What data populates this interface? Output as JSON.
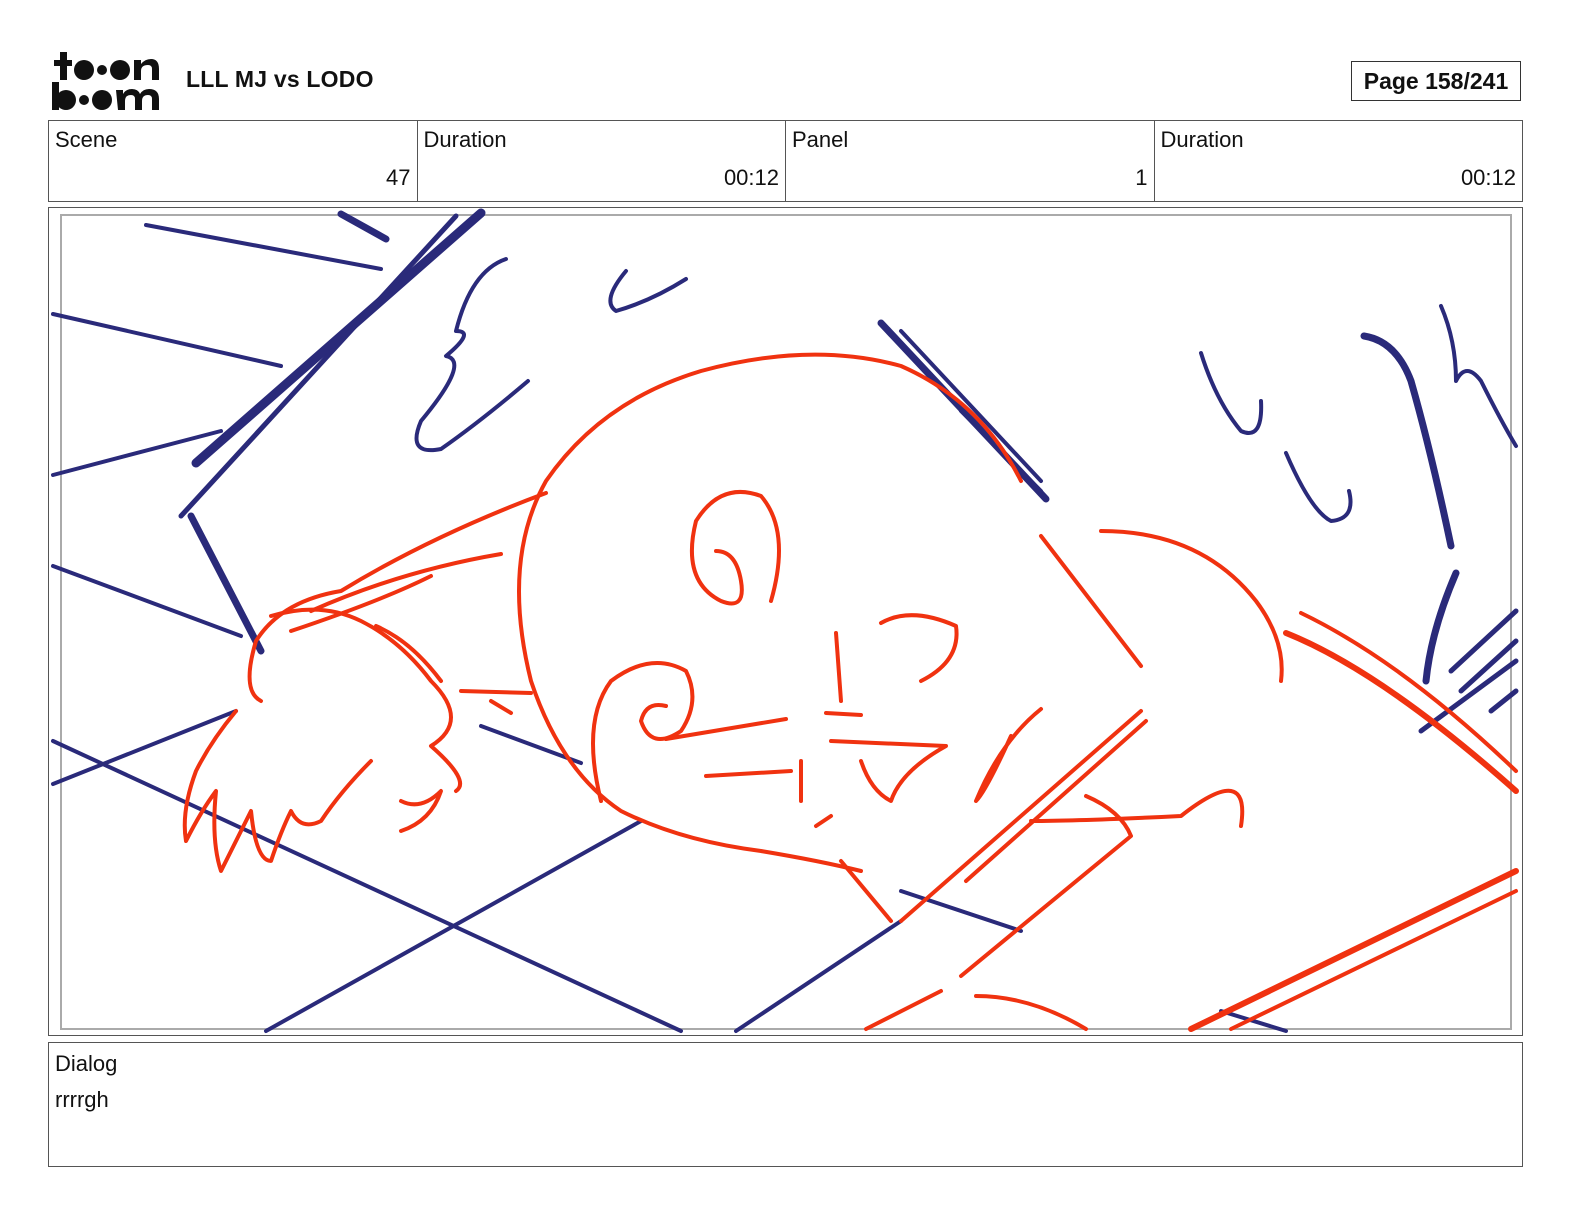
{
  "header": {
    "logo_text": "toon boom",
    "project_title": "LLL MJ vs LODO",
    "page_label": "Page 158/241"
  },
  "info": {
    "scene_label": "Scene",
    "scene_value": "47",
    "scene_duration_label": "Duration",
    "scene_duration_value": "00:12",
    "panel_label": "Panel",
    "panel_value": "1",
    "panel_duration_label": "Duration",
    "panel_duration_value": "00:12"
  },
  "dialog": {
    "label": "Dialog",
    "text": "rrrrgh"
  },
  "colors": {
    "sketch_blue": "#2a2a7a",
    "sketch_red": "#f03210"
  }
}
